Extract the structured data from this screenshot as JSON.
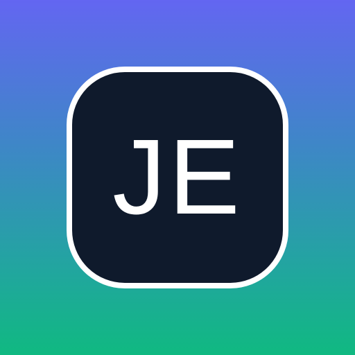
{
  "icon": {
    "initials": "JE",
    "colors": {
      "gradient_top": "#6366f1",
      "gradient_bottom": "#10b981",
      "tile_fill": "#0f1a2c",
      "tile_border": "#ffffff",
      "text": "#ffffff"
    }
  }
}
